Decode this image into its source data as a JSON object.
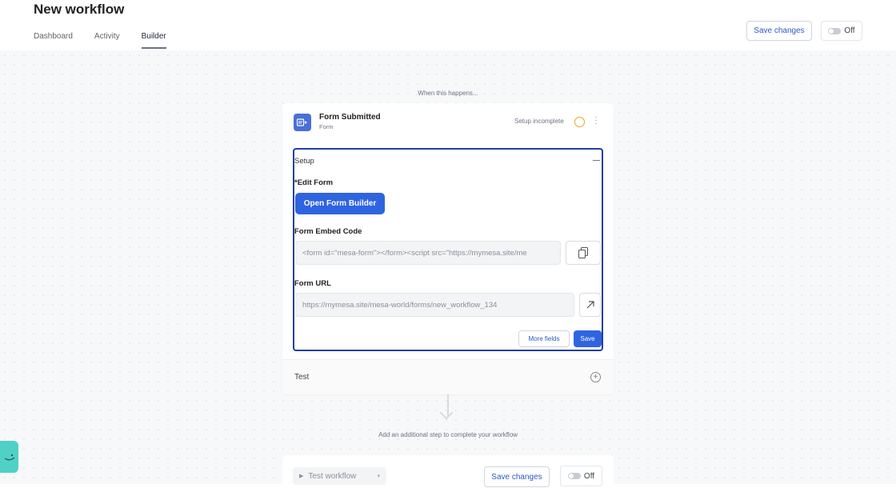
{
  "header": {
    "title": "New workflow",
    "tabs": [
      {
        "label": "Dashboard",
        "active": false
      },
      {
        "label": "Activity",
        "active": false
      },
      {
        "label": "Builder",
        "active": true
      }
    ],
    "save_label": "Save changes",
    "toggle_label": "Off"
  },
  "canvas": {
    "when_label": "When this happens...",
    "add_step_label": "Add an additional step to complete your workflow"
  },
  "trigger": {
    "title": "Form Submitted",
    "subtitle": "Form",
    "status": "Setup incomplete",
    "icon": "form-icon"
  },
  "setup": {
    "label": "Setup",
    "edit_form_label": "*Edit Form",
    "open_builder_label": "Open Form Builder",
    "embed_label": "Form Embed Code",
    "embed_value": "<form id=\"mesa-form\"></form><script src=\"https://mymesa.site/me",
    "url_label": "Form URL",
    "url_value": "https://mymesa.site/mesa-world/forms/new_workflow_134",
    "more_fields_label": "More fields",
    "save_label": "Save"
  },
  "test": {
    "label": "Test"
  },
  "bottom_bar": {
    "test_workflow_label": "Test workflow",
    "save_label": "Save changes",
    "toggle_label": "Off"
  },
  "colors": {
    "primary": "#2f64e0",
    "focus_border": "#1f3fa6",
    "warning": "#e5a52b",
    "help_widget": "#4fd1c5"
  }
}
